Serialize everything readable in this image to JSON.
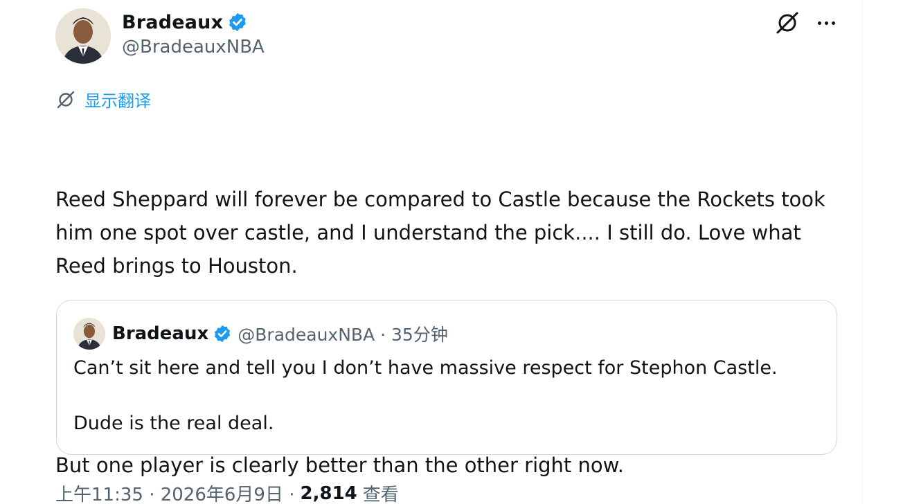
{
  "colors": {
    "accent": "#1d9bf0",
    "text": "#0f1419",
    "secondary": "#536471",
    "border": "#cfd9de"
  },
  "author": {
    "display_name": "Bradeaux",
    "handle": "@BradeauxNBA",
    "verified_icon": "verified-badge-icon"
  },
  "header_actions": {
    "grok_icon": "grok-icon",
    "more_icon": "more-dots-icon"
  },
  "translate": {
    "icon": "grok-icon",
    "label": "显示翻译"
  },
  "tweet": {
    "paragraph_1": "Reed Sheppard will forever be compared to Castle because the Rockets took him one spot over castle, and I understand the pick.... I still do. Love what Reed brings to Houston.",
    "paragraph_2": "But one player is clearly better than the other right now."
  },
  "quote": {
    "display_name": "Bradeaux",
    "handle_time": "@BradeauxNBA · 35分钟",
    "paragraph_1": "Can’t sit here and tell you I don’t have massive respect for Stephon Castle.",
    "paragraph_2": "Dude is the real deal."
  },
  "footer": {
    "timestamp": "上午11:35 · 2026年6月9日 ·",
    "views_count": "2,814",
    "views_label": "查看"
  }
}
